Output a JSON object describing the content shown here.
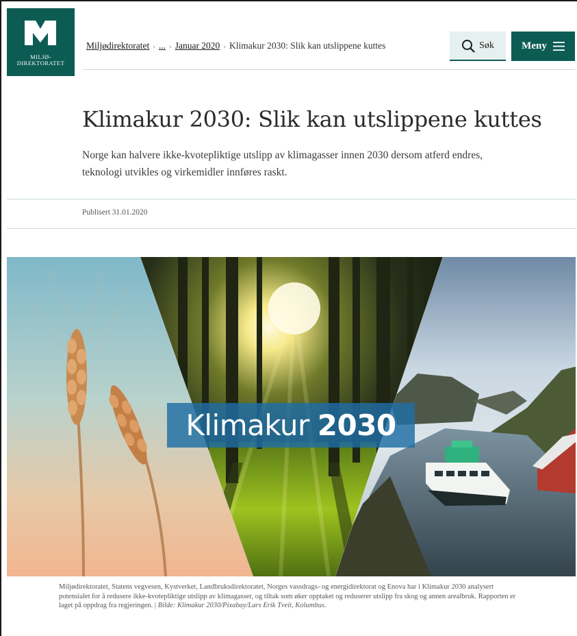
{
  "header": {
    "logo": {
      "line1": "MILJØ-",
      "line2": "DIREKTORATET",
      "alt": "miljodirektoratet-logo"
    },
    "breadcrumb": {
      "items": [
        {
          "label": "Miljødirektoratet",
          "link": true
        },
        {
          "label": "...",
          "link": true
        },
        {
          "label": "Januar 2020",
          "link": true
        },
        {
          "label": "Klimakur 2030: Slik kan utslippene kuttes",
          "link": false
        }
      ],
      "separator": "›"
    },
    "search_label": "Søk",
    "menu_label": "Meny"
  },
  "article": {
    "title": "Klimakur 2030: Slik kan utslippene kuttes",
    "lede": "Norge kan halvere ikke-kvotepliktige utslipp av klimagasser innen 2030 dersom atferd endres, teknologi utvikles og virkemidler innføres raskt.",
    "published": "Publisert 31.01.2020"
  },
  "hero": {
    "banner_light": "Klimakur",
    "banner_bold": "2030"
  },
  "caption": {
    "text": "Miljødirektoratet, Statens vegvesen, Kystverket, Landbruksdirektoratet, Norges vassdrags- og energidirektorat og Enova har i Klimakur 2030 analysert potensialet for å redusere ikke-kvotepliktige utslipp av klimagasser, og tiltak som øker opptaket og reduserer utslipp fra skog og annen arealbruk. Rapporten er laget på oppdrag fra regjeringen. | ",
    "credit": "Bilde: Klimakur 2030/Pixabay/Lars Erik Tveit, Kolumbus."
  },
  "colors": {
    "brand": "#0d5c54",
    "search_bg": "#e6f0ee",
    "banner": "#1e6ea5"
  },
  "icons": {
    "search": "search-icon",
    "menu": "hamburger-icon"
  }
}
